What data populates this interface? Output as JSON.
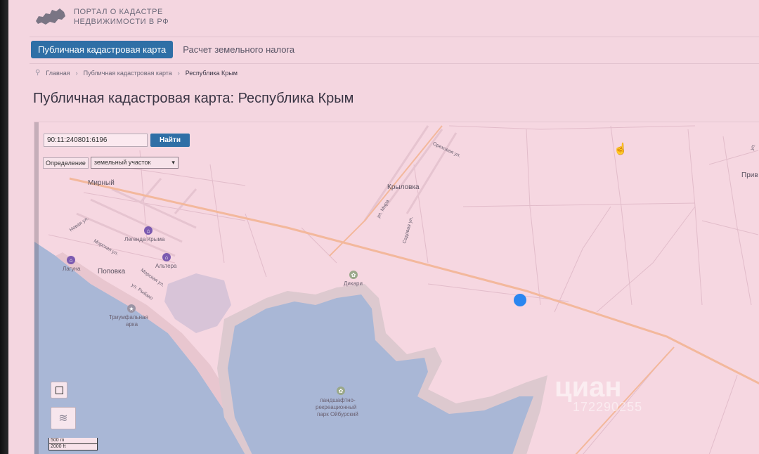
{
  "header": {
    "logo_text_line1": "ПОРТАЛ О КАДАСТРЕ",
    "logo_text_line2": "НЕДВИЖИМОСТИ В РФ"
  },
  "nav": {
    "active": "Публичная кадастровая карта",
    "link": "Расчет земельного налога"
  },
  "breadcrumb": {
    "items": [
      "Главная",
      "Публичная кадастровая карта",
      "Республика Крым"
    ]
  },
  "page": {
    "title": "Публичная кадастровая карта: Республика Крым"
  },
  "search": {
    "value": "90:11:240801:6196",
    "button": "Найти"
  },
  "definition": {
    "label": "Определение",
    "selected": "земельный участок"
  },
  "map": {
    "places": [
      "Мирный",
      "Крыловка",
      "Поповка",
      "Прив"
    ],
    "pois": [
      "Легенда Крыма",
      "Лагуна",
      "Альтера",
      "Дикари",
      "Триумфальная",
      "арка",
      "ландшафтно-",
      "рекреационный",
      "парк Ойбурский"
    ],
    "streets": [
      "Новая ул.",
      "Морская ул.",
      "Морская ул.",
      "ул. Рыбако",
      "ул. Мира",
      "Садовая ул.",
      "Ореховая ул.",
      "ул."
    ],
    "scale": [
      "500 m",
      "2000 ft"
    ],
    "watermark": "циан",
    "watermark_code": "172290255"
  },
  "colors": {
    "accent": "#2f6fa6",
    "marker": "#2a86f0",
    "water": "#a9b7d6"
  }
}
